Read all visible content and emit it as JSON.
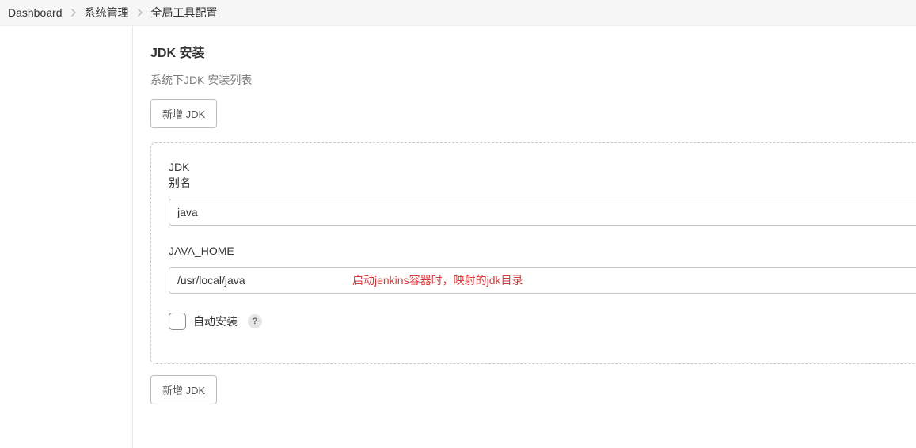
{
  "breadcrumb": {
    "items": [
      {
        "label": "Dashboard"
      },
      {
        "label": "系统管理"
      },
      {
        "label": "全局工具配置"
      }
    ]
  },
  "section": {
    "title": "JDK 安装",
    "subtitle": "系统下JDK 安装列表",
    "add_button_label": "新增 JDK"
  },
  "jdk_entry": {
    "group_label": "JDK",
    "alias_label": "别名",
    "alias_value": "java",
    "java_home_label": "JAVA_HOME",
    "java_home_value": "/usr/local/java",
    "auto_install_label": "自动安装",
    "auto_install_checked": false,
    "help_icon": "?"
  },
  "annotation": {
    "text": "启动jenkins容器时，映射的jdk目录"
  }
}
